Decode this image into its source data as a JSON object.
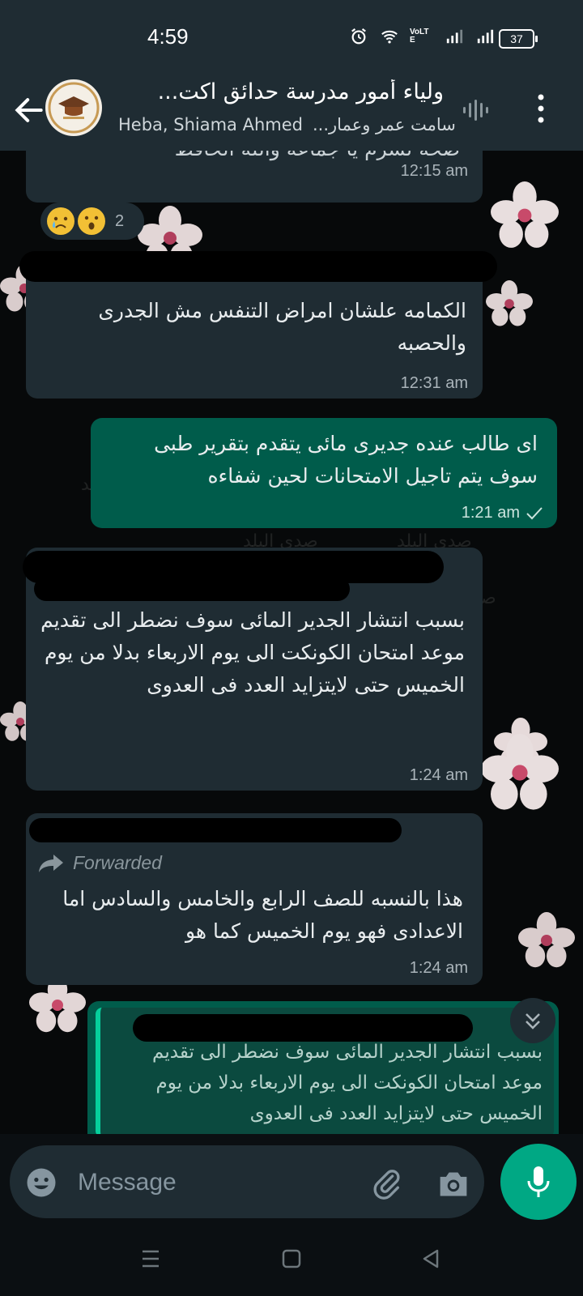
{
  "status_bar": {
    "time": "4:59",
    "volte_label": "VoLTE",
    "battery": "37"
  },
  "header": {
    "title": "ولياء أمور مدرسة حدائق اكت...",
    "subtitle_names": "Heba, Shiama Ahmed",
    "subtitle_more": "...سامت عمر وعمار"
  },
  "messages": [
    {
      "id": "m1",
      "direction": "in",
      "text_partial": "صحة لشرم يا جماعة والله الحافظ",
      "time": "12:15 am",
      "reaction_count": "2"
    },
    {
      "id": "m2",
      "direction": "in",
      "text": "الكمامه علشان امراض التنفس مش الجدرى والحصبه",
      "time": "12:31 am"
    },
    {
      "id": "m3",
      "direction": "out",
      "text": "اى طالب عنده جديرى مائى يتقدم بتقرير طبى سوف يتم تاجيل الامتحانات لحين شفاءه",
      "time": "1:21 am"
    },
    {
      "id": "m4",
      "direction": "in",
      "text": "بسبب انتشار الجدير المائى سوف نضطر الى تقديم موعد امتحان الكونكت  الى يوم الاربعاء بدلا من يوم الخميس حتى لايتزايد العدد فى العدوى",
      "time": "1:24 am"
    },
    {
      "id": "m5",
      "direction": "in",
      "forwarded_label": "Forwarded",
      "text": "هذا بالنسبه للصف الرابع والخامس والسادس اما الاعدادى فهو يوم الخميس كما هو",
      "time": "1:24 am"
    },
    {
      "id": "m6",
      "direction": "out",
      "quote": "بسبب انتشار الجدير المائى سوف نضطر الى تقديم موعد امتحان الكونكت  الى يوم الاربعاء بدلا من يوم الخميس حتى لايتزايد العدد فى العدوى"
    }
  ],
  "watermark": {
    "text": "صدى البلد"
  },
  "composer": {
    "placeholder": "Message"
  },
  "colors": {
    "header_bg": "#1f2c33",
    "incoming_bubble": "#1f2c33",
    "outgoing_bubble": "#005c4b",
    "accent": "#00a884"
  }
}
